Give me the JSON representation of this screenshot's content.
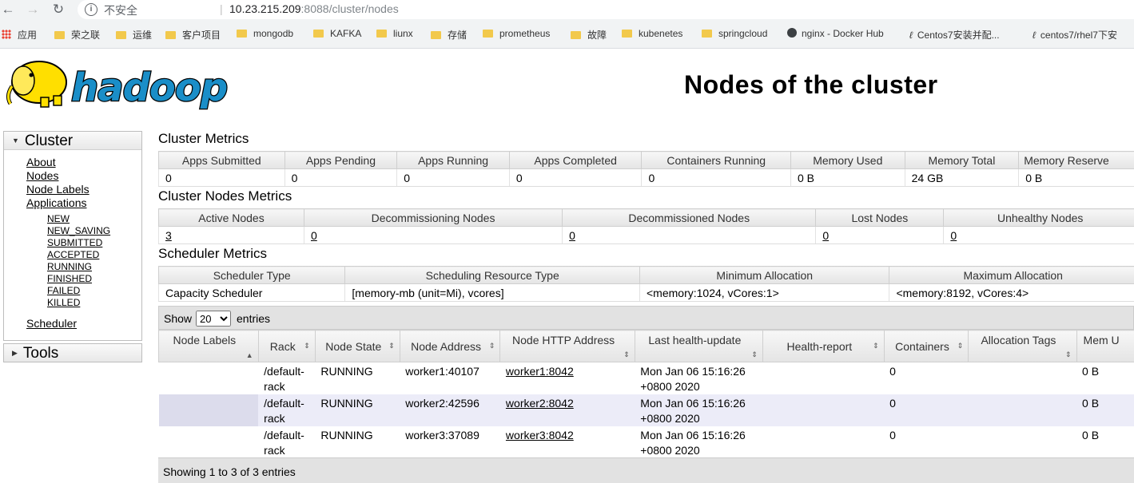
{
  "browser": {
    "security_label": "不安全",
    "url_host": "10.23.215.209",
    "url_path": ":8088/cluster/nodes",
    "bookmarks": [
      {
        "label": "应用",
        "icon": "apps-grid-icon"
      },
      {
        "label": "荣之联",
        "icon": "folder-icon"
      },
      {
        "label": "运维",
        "icon": "folder-icon"
      },
      {
        "label": "客户项目",
        "icon": "folder-icon"
      },
      {
        "label": "mongodb",
        "icon": "folder-icon"
      },
      {
        "label": "KAFKA",
        "icon": "folder-icon"
      },
      {
        "label": "liunx",
        "icon": "folder-icon"
      },
      {
        "label": "存储",
        "icon": "folder-icon"
      },
      {
        "label": "prometheus",
        "icon": "folder-icon"
      },
      {
        "label": "故障",
        "icon": "folder-icon"
      },
      {
        "label": "kubenetes",
        "icon": "folder-icon"
      },
      {
        "label": "springcloud",
        "icon": "folder-icon"
      },
      {
        "label": "nginx - Docker Hub",
        "icon": "globe-icon"
      },
      {
        "label": "Centos7安装并配...",
        "icon": "link-icon"
      },
      {
        "label": "centos7/rhel7下安",
        "icon": "link-icon"
      }
    ]
  },
  "header": {
    "logo_text": "hadoop",
    "title": "Nodes of the cluster"
  },
  "sidebar": {
    "cluster": {
      "heading": "Cluster",
      "links": [
        "About",
        "Nodes",
        "Node Labels",
        "Applications"
      ],
      "app_states": [
        "NEW",
        "NEW_SAVING",
        "SUBMITTED",
        "ACCEPTED",
        "RUNNING",
        "FINISHED",
        "FAILED",
        "KILLED"
      ],
      "scheduler": "Scheduler"
    },
    "tools": {
      "heading": "Tools"
    }
  },
  "cluster_metrics": {
    "title": "Cluster Metrics",
    "headers": [
      "Apps Submitted",
      "Apps Pending",
      "Apps Running",
      "Apps Completed",
      "Containers Running",
      "Memory Used",
      "Memory Total",
      "Memory Reserve"
    ],
    "values": [
      "0",
      "0",
      "0",
      "0",
      "0",
      "0 B",
      "24 GB",
      "0 B"
    ]
  },
  "nodes_metrics": {
    "title": "Cluster Nodes Metrics",
    "headers": [
      "Active Nodes",
      "Decommissioning Nodes",
      "Decommissioned Nodes",
      "Lost Nodes",
      "Unhealthy Nodes"
    ],
    "values": [
      "3",
      "0",
      "0",
      "0",
      "0"
    ]
  },
  "scheduler_metrics": {
    "title": "Scheduler Metrics",
    "headers": [
      "Scheduler Type",
      "Scheduling Resource Type",
      "Minimum Allocation",
      "Maximum Allocation"
    ],
    "values": [
      "Capacity Scheduler",
      "[memory-mb (unit=Mi), vcores]",
      "<memory:1024, vCores:1>",
      "<memory:8192, vCores:4>"
    ]
  },
  "datatable": {
    "show_label": "Show",
    "page_size": "20",
    "entries_label": "entries",
    "columns": [
      "Node Labels",
      "Rack",
      "Node State",
      "Node Address",
      "Node HTTP Address",
      "Last health-update",
      "Health-report",
      "Containers",
      "Allocation Tags",
      "Mem U"
    ],
    "rows": [
      {
        "labels": "",
        "rack1": "/default-",
        "rack2": "rack",
        "state": "RUNNING",
        "address": "worker1:40107",
        "http": "worker1:8042",
        "health1": "Mon Jan 06 15:16:26",
        "health2": "+0800 2020",
        "report": "",
        "containers": "0",
        "tags": "",
        "mem": "0 B"
      },
      {
        "labels": "",
        "rack1": "/default-",
        "rack2": "rack",
        "state": "RUNNING",
        "address": "worker2:42596",
        "http": "worker2:8042",
        "health1": "Mon Jan 06 15:16:26",
        "health2": "+0800 2020",
        "report": "",
        "containers": "0",
        "tags": "",
        "mem": "0 B"
      },
      {
        "labels": "",
        "rack1": "/default-",
        "rack2": "rack",
        "state": "RUNNING",
        "address": "worker3:37089",
        "http": "worker3:8042",
        "health1": "Mon Jan 06 15:16:26",
        "health2": "+0800 2020",
        "report": "",
        "containers": "0",
        "tags": "",
        "mem": "0 B"
      }
    ],
    "footer": "Showing 1 to 3 of 3 entries"
  },
  "colors": {
    "logo_blue": "#1a8ec8",
    "logo_yellow": "#ffdf00",
    "row_alt": "#ececf8"
  }
}
